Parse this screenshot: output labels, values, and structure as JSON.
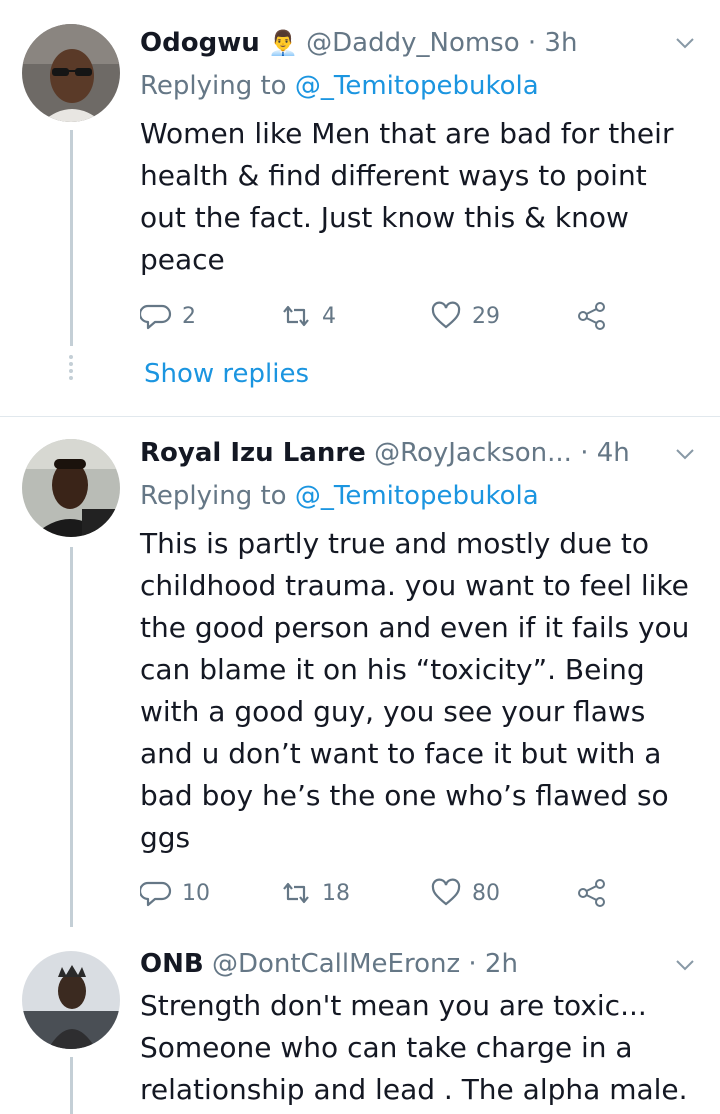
{
  "tweets": [
    {
      "name": "Odogwu",
      "badge": "👨‍💼",
      "handle": "@Daddy_Nomso",
      "time": "3h",
      "replying_prefix": "Replying to",
      "replying_handle": "@_Temitopebukola",
      "text": "Women like Men that are bad for their health & find different ways to point out the fact. Just know this & know peace",
      "replies": "2",
      "retweets": "4",
      "likes": "29",
      "show_replies": "Show replies"
    },
    {
      "name": "Royal Izu Lanre",
      "handle": "@RoyJackson...",
      "time": "4h",
      "replying_prefix": "Replying to",
      "replying_handle": "@_Temitopebukola",
      "text": "This is partly true and mostly due to childhood trauma. you want to feel like the good person and even if it fails you can blame it on his “toxicity”. Being with a good guy, you see your flaws and u don’t want to face it but with a bad boy he’s the one who’s flawed so ggs",
      "replies": "10",
      "retweets": "18",
      "likes": "80"
    },
    {
      "name": "ONB",
      "handle": "@DontCallMeEronz",
      "time": "2h",
      "text": "Strength don't mean you are toxic... Someone who can take charge in a relationship and lead . The alpha male."
    }
  ],
  "separator": "·",
  "icons": [
    "chevron-down-icon",
    "reply-icon",
    "retweet-icon",
    "like-icon",
    "share-icon"
  ],
  "colors": {
    "link": "#1b95e0",
    "muted": "#657786",
    "text": "#141823",
    "line": "#c4cfd6"
  }
}
